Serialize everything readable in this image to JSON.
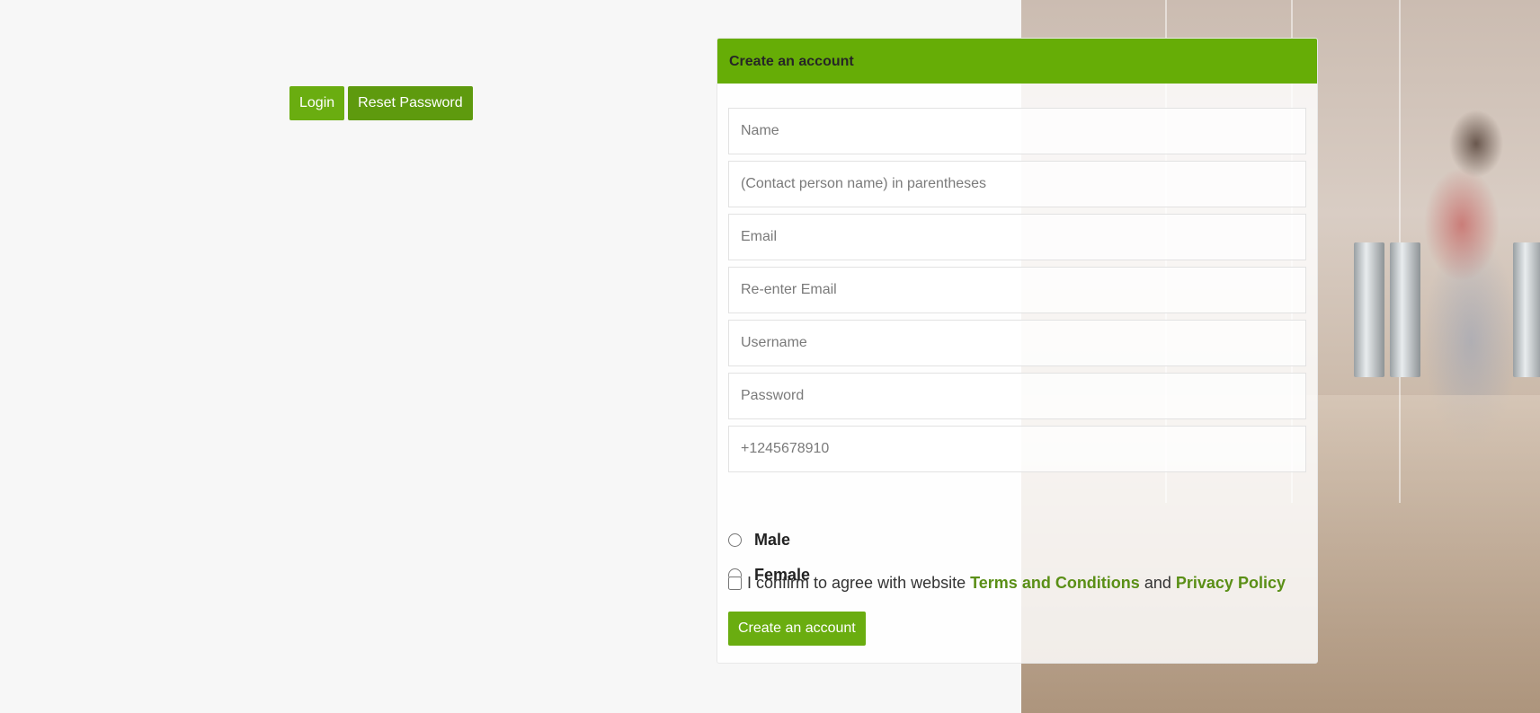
{
  "top_actions": {
    "login_label": "Login",
    "reset_password_label": "Reset Password"
  },
  "signup": {
    "header": "Create an account",
    "fields": {
      "name_placeholder": "Name",
      "contact_placeholder": "(Contact person name) in parentheses",
      "email_placeholder": "Email",
      "reenter_email_placeholder": "Re-enter Email",
      "username_placeholder": "Username",
      "password_placeholder": "Password",
      "phone_placeholder": "+1245678910"
    },
    "gender": {
      "male_label": "Male",
      "female_label": "Female"
    },
    "terms": {
      "prefix": "I confirm to agree with website",
      "terms_link": "Terms and Conditions",
      "and": "and",
      "privacy_link": "Privacy Policy"
    },
    "submit_label": "Create an account"
  },
  "colors": {
    "accent": "#6aad10",
    "link": "#5a8f16"
  },
  "icons": {
    "background": "office-photo-image"
  }
}
